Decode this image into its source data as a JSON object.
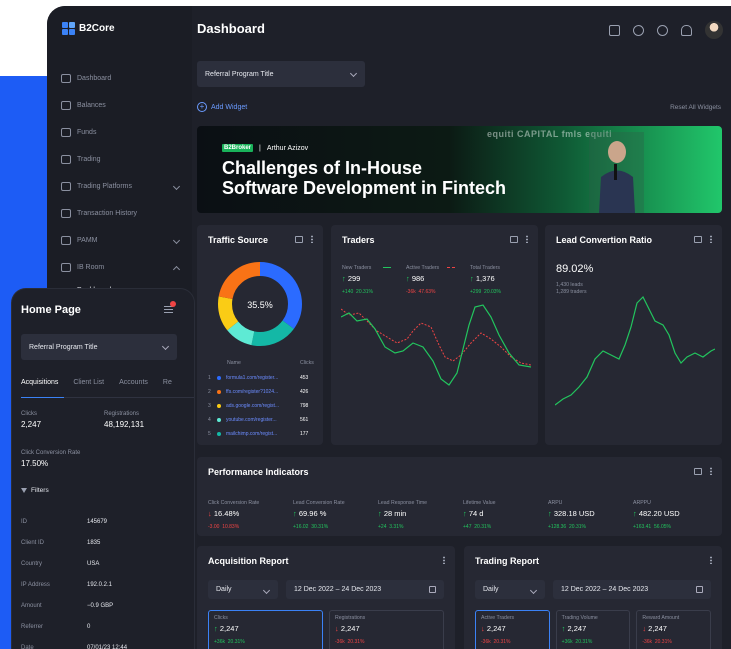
{
  "app": {
    "name": "B2Core",
    "page_title": "Dashboard"
  },
  "sidebar": {
    "items": [
      {
        "label": "Dashboard",
        "icon": "dashboard-icon"
      },
      {
        "label": "Balances",
        "icon": "wallet-icon"
      },
      {
        "label": "Funds",
        "icon": "star-icon"
      },
      {
        "label": "Trading",
        "icon": "chart-icon"
      },
      {
        "label": "Trading Platforms",
        "icon": "layers-icon"
      },
      {
        "label": "Transaction History",
        "icon": "history-icon"
      },
      {
        "label": "PAMM",
        "icon": "pamm-icon"
      },
      {
        "label": "IB Room",
        "icon": "ib-icon"
      }
    ],
    "sub_item": "Dashboard"
  },
  "toolbar": {
    "select_value": "Referral Program Title",
    "add_widget": "Add Widget",
    "reset_widgets": "Reset All Widgets"
  },
  "banner": {
    "brand": "B2Broker",
    "speaker": "Arthur Azizov",
    "headline_line1": "Challenges of In-House",
    "headline_line2": "Software Development in Fintech",
    "partners": "equiti CAPITAL   fmls   equiti"
  },
  "traffic": {
    "title": "Traffic Source",
    "center_label": "35.5%",
    "headers": {
      "name": "Name",
      "clicks": "Clicks"
    },
    "rows": [
      {
        "n": "1",
        "source": "formula1.com/register...",
        "clicks": "453",
        "color": "#2b6bff"
      },
      {
        "n": "2",
        "source": "ffs.com/register?1024...",
        "clicks": "426",
        "color": "#f97316"
      },
      {
        "n": "3",
        "source": "ads.google.com/regist...",
        "clicks": "798",
        "color": "#facc15"
      },
      {
        "n": "4",
        "source": "youtube.com/register...",
        "clicks": "561",
        "color": "#5eead4"
      },
      {
        "n": "5",
        "source": "mailchimp.com/regist...",
        "clicks": "177",
        "color": "#14b8a6"
      }
    ]
  },
  "traders": {
    "title": "Traders",
    "stats": [
      {
        "label": "New Traders",
        "value": "299",
        "delta": "+140",
        "pct": "20.31%",
        "trend": "up"
      },
      {
        "label": "Active Traders",
        "value": "986",
        "delta": "-36k",
        "pct": "47.63%",
        "trend": "up"
      },
      {
        "label": "Total Traders",
        "value": "1,376",
        "delta": "+299",
        "pct": "20.03%",
        "trend": "up"
      }
    ]
  },
  "lead": {
    "title": "Lead Convertion Ratio",
    "value": "89.02%",
    "sub1": "1,430 leads",
    "sub2": "1,289 traders"
  },
  "performance": {
    "title": "Performance Indicators",
    "items": [
      {
        "label": "Click Conversion Rate",
        "value": "16.48%",
        "delta": "-3.00",
        "pct": "10.83%",
        "trend": "down"
      },
      {
        "label": "Lead Conversion Rate",
        "value": "69.96 %",
        "delta": "+16.02",
        "pct": "30.31%",
        "trend": "up"
      },
      {
        "label": "Lead Response Time",
        "value": "28 min",
        "delta": "+24",
        "pct": "3.31%",
        "trend": "up"
      },
      {
        "label": "Lifetime Value",
        "value": "74 d",
        "delta": "+47",
        "pct": "20.31%",
        "trend": "up"
      },
      {
        "label": "ARPU",
        "value": "328.18 USD",
        "delta": "+128.36",
        "pct": "20.31%",
        "trend": "up"
      },
      {
        "label": "ARPPU",
        "value": "482.20 USD",
        "delta": "+163.41",
        "pct": "56.05%",
        "trend": "up"
      }
    ]
  },
  "acquisition": {
    "title": "Acquisition Report",
    "period": "Daily",
    "range": "12 Dec 2022 – 24 Dec 2023",
    "tiles": [
      {
        "label": "Clicks",
        "value": "2,247",
        "delta": "+36k",
        "pct": "20.31%",
        "trend": "up"
      },
      {
        "label": "Registrations",
        "value": "2,247",
        "delta": "-36k",
        "pct": "20.31%",
        "trend": "down"
      }
    ]
  },
  "trading_report": {
    "title": "Trading Report",
    "period": "Daily",
    "range": "12 Dec 2022 – 24 Dec 2023",
    "tiles": [
      {
        "label": "Active Traders",
        "value": "2,247",
        "delta": "-36k",
        "pct": "20.31%",
        "trend": "down"
      },
      {
        "label": "Trading Volume",
        "value": "2,247",
        "delta": "+36k",
        "pct": "20.31%",
        "trend": "up"
      },
      {
        "label": "Reward Amount",
        "value": "2,247",
        "delta": "-36k",
        "pct": "20.31%",
        "trend": "down"
      }
    ]
  },
  "mobile": {
    "title": "Home Page",
    "select_value": "Referral Program Title",
    "tabs": [
      "Acquisitions",
      "Client List",
      "Accounts",
      "Re"
    ],
    "clicks_label": "Clicks",
    "clicks_value": "2,247",
    "reg_label": "Registrations",
    "reg_value": "48,192,131",
    "ccr_label": "Click Conversion Rate",
    "ccr_value": "17.50%",
    "filters": "Filters",
    "details": [
      {
        "k": "ID",
        "v": "145679"
      },
      {
        "k": "Client ID",
        "v": "1835"
      },
      {
        "k": "Country",
        "v": "USA"
      },
      {
        "k": "IP Address",
        "v": "192.0.2.1"
      },
      {
        "k": "Amount",
        "v": "−0.9 GBP"
      },
      {
        "k": "Referrer",
        "v": "0"
      },
      {
        "k": "Date",
        "v": "07/01/23 12:44"
      }
    ]
  },
  "colors": {
    "accent": "#3b82f6",
    "up": "#22c55e",
    "down": "#ef4444",
    "panel": "#262833",
    "bg": "#1e2029"
  }
}
